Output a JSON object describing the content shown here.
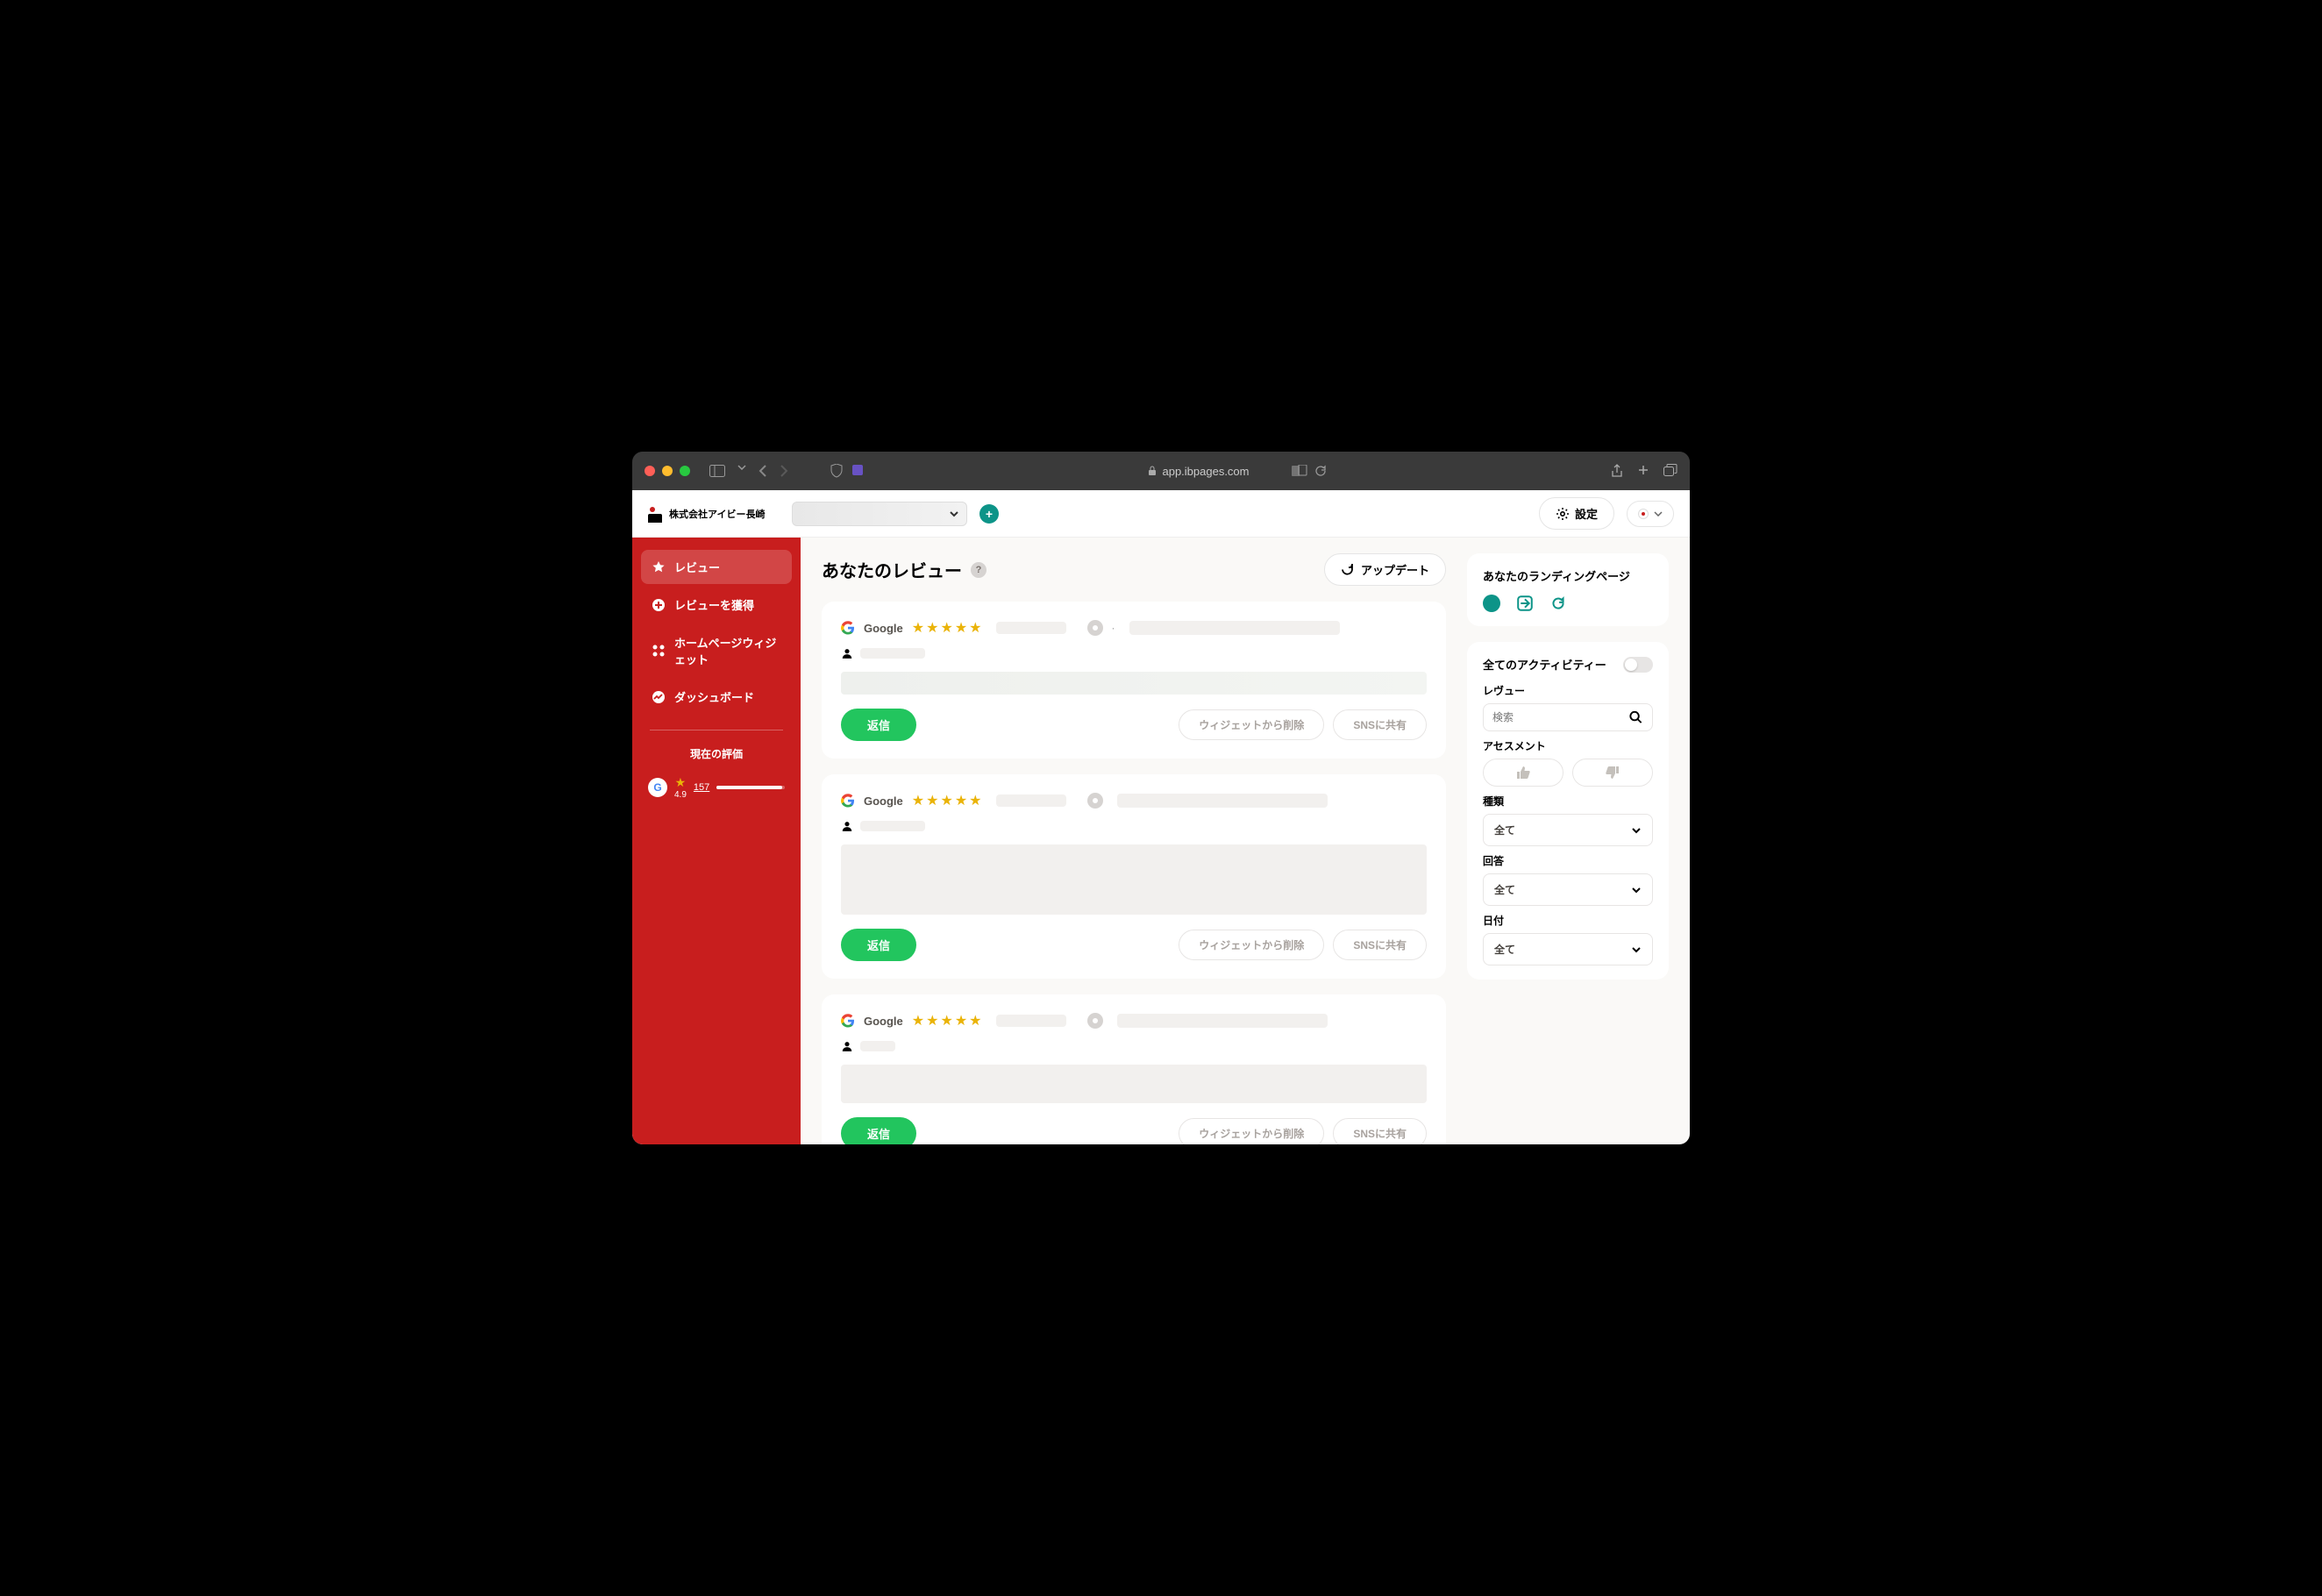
{
  "browser": {
    "url": "app.ibpages.com"
  },
  "topbar": {
    "company": "株式会社アイビー長崎",
    "settings_label": "設定"
  },
  "sidebar": {
    "items": [
      {
        "label": "レビュー"
      },
      {
        "label": "レビューを獲得"
      },
      {
        "label": "ホームページウィジェット"
      },
      {
        "label": "ダッシュボード"
      }
    ],
    "rating_title": "現在の評価",
    "rating_value": "4.9",
    "rating_count": "157"
  },
  "main": {
    "title": "あなたのレビュー",
    "update_label": "アップデート",
    "reviews": [
      {
        "source": "Google",
        "stars": 5,
        "reply_label": "返信",
        "remove_label": "ウィジェットから削除",
        "share_label": "SNSに共有"
      },
      {
        "source": "Google",
        "stars": 5,
        "reply_label": "返信",
        "remove_label": "ウィジェットから削除",
        "share_label": "SNSに共有"
      },
      {
        "source": "Google",
        "stars": 5,
        "reply_label": "返信",
        "remove_label": "ウィジェットから削除",
        "share_label": "SNSに共有"
      }
    ]
  },
  "right": {
    "landing_title": "あなたのランディングページ",
    "all_activity": "全てのアクティビティー",
    "review_section": "レヴュー",
    "search_placeholder": "検索",
    "assessment": "アセスメント",
    "type_label": "種類",
    "answer_label": "回答",
    "date_label": "日付",
    "option_all": "全て"
  }
}
